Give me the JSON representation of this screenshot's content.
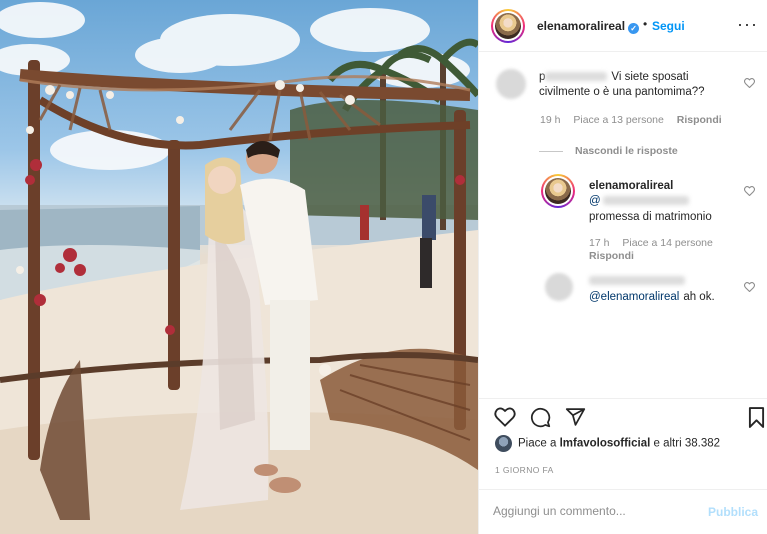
{
  "post": {
    "image_alt": "wedding kiss on the beach",
    "accent": "#0095f6"
  },
  "header": {
    "username": "elenamoralireal",
    "verified_icon": "verified-badge-icon",
    "separator": "•",
    "follow_label": "Segui",
    "more_icon": "more-options-icon",
    "more_label": "···"
  },
  "comments": [
    {
      "user_initial": "p",
      "text": "Vi siete sposati civilmente o è una pantomima??",
      "time": "19 h",
      "likes": "Piace a 13 persone",
      "reply_label": "Rispondi"
    }
  ],
  "hide_replies_label": "Nascondi le risposte",
  "replies": [
    {
      "username": "elenamoralireal",
      "mention": "@",
      "text": "promessa di matrimonio",
      "time": "17 h",
      "likes": "Piace a 14 persone",
      "reply_label": "Rispondi"
    },
    {
      "mention": "@elenamoralireal",
      "text": "ah ok."
    }
  ],
  "actions": {
    "like_icon": "heart-icon",
    "comment_icon": "comment-icon",
    "share_icon": "share-icon",
    "save_icon": "bookmark-icon"
  },
  "likes": {
    "prefix": "Piace a",
    "user": "lmfavolosofficial",
    "suffix": "e altri 38.382"
  },
  "date": "1 GIORNO FA",
  "add_comment": {
    "placeholder": "Aggiungi un commento...",
    "publish_label": "Pubblica",
    "publish_color": "#b2dffc"
  }
}
